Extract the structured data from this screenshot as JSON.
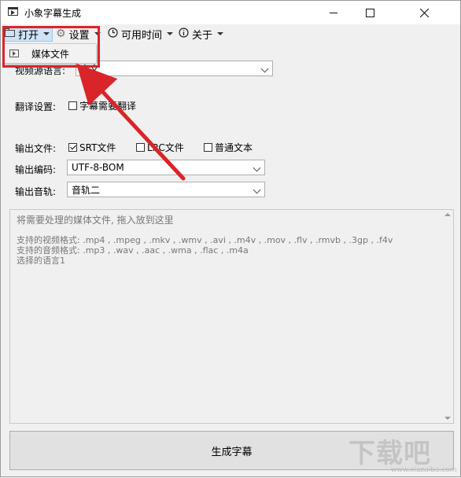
{
  "window": {
    "title": "小象字幕生成"
  },
  "menu": {
    "open": "打开",
    "settings": "设置",
    "available_time": "可用时间",
    "about": "关于"
  },
  "dropdown": {
    "items": [
      {
        "label": "媒体文件",
        "icon": "play-file-icon"
      }
    ]
  },
  "form": {
    "video_lang_label": "视频源语言:",
    "video_lang_value": "中文",
    "translate_label": "翻译设置:",
    "translate_checkbox": "字幕需要翻译",
    "output_file_label": "输出文件:",
    "srt_label": "SRT文件",
    "srt_checked": true,
    "lrc_label": "LRC文件",
    "lrc_checked": false,
    "txt_label": "普通文本",
    "txt_checked": false,
    "encoding_label": "输出编码:",
    "encoding_value": "UTF-8-BOM",
    "track_label": "输出音轨:",
    "track_value": "音轨二"
  },
  "log": {
    "line1": "将需要处理的媒体文件, 拖入放到这里",
    "line2": "支持的视频格式: .mp4 , .mpeg , .mkv , .wmv , .avi , .m4v , .mov , .flv , .rmvb , .3gp , .f4v",
    "line3": "支持的音频格式: .mp3 , .wav , .aac , .wma , .flac , .m4a",
    "line4": "选择的语言1"
  },
  "generate_button": "生成字幕",
  "watermark": {
    "text": "下载吧",
    "url": "www.xiazaiba.com"
  },
  "colors": {
    "highlight": "#d9252a",
    "menu_selected": "#cce4f7"
  }
}
